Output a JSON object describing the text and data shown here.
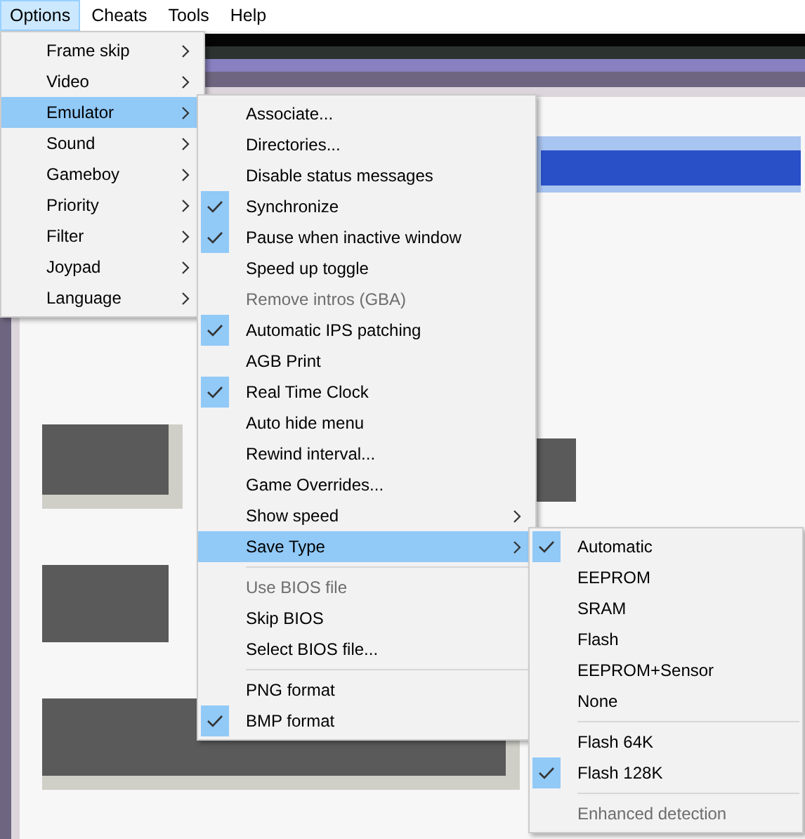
{
  "menu_bar": [
    {
      "label": "Options",
      "selected": true
    },
    {
      "label": "Cheats",
      "selected": false
    },
    {
      "label": "Tools",
      "selected": false
    },
    {
      "label": "Help",
      "selected": false
    }
  ],
  "options_menu": [
    {
      "label": "Frame skip",
      "selected": false,
      "has_submenu": true
    },
    {
      "label": "Video",
      "selected": false,
      "has_submenu": true
    },
    {
      "label": "Emulator",
      "selected": true,
      "has_submenu": true
    },
    {
      "label": "Sound",
      "selected": false,
      "has_submenu": true
    },
    {
      "label": "Gameboy",
      "selected": false,
      "has_submenu": true
    },
    {
      "label": "Priority",
      "selected": false,
      "has_submenu": true
    },
    {
      "label": "Filter",
      "selected": false,
      "has_submenu": true
    },
    {
      "label": "Joypad",
      "selected": false,
      "has_submenu": true
    },
    {
      "label": "Language",
      "selected": false,
      "has_submenu": true
    }
  ],
  "emulator_menu": [
    {
      "kind": "item",
      "label": "Associate...",
      "checked": false,
      "disabled": false,
      "selected": false,
      "has_submenu": false
    },
    {
      "kind": "item",
      "label": "Directories...",
      "checked": false,
      "disabled": false,
      "selected": false,
      "has_submenu": false
    },
    {
      "kind": "item",
      "label": "Disable status messages",
      "checked": false,
      "disabled": false,
      "selected": false,
      "has_submenu": false
    },
    {
      "kind": "item",
      "label": "Synchronize",
      "checked": true,
      "disabled": false,
      "selected": false,
      "has_submenu": false
    },
    {
      "kind": "item",
      "label": "Pause when inactive window",
      "checked": true,
      "disabled": false,
      "selected": false,
      "has_submenu": false
    },
    {
      "kind": "item",
      "label": "Speed up toggle",
      "checked": false,
      "disabled": false,
      "selected": false,
      "has_submenu": false
    },
    {
      "kind": "item",
      "label": "Remove intros (GBA)",
      "checked": false,
      "disabled": true,
      "selected": false,
      "has_submenu": false
    },
    {
      "kind": "item",
      "label": "Automatic IPS patching",
      "checked": true,
      "disabled": false,
      "selected": false,
      "has_submenu": false
    },
    {
      "kind": "item",
      "label": "AGB Print",
      "checked": false,
      "disabled": false,
      "selected": false,
      "has_submenu": false
    },
    {
      "kind": "item",
      "label": "Real Time Clock",
      "checked": true,
      "disabled": false,
      "selected": false,
      "has_submenu": false
    },
    {
      "kind": "item",
      "label": "Auto hide menu",
      "checked": false,
      "disabled": false,
      "selected": false,
      "has_submenu": false
    },
    {
      "kind": "item",
      "label": "Rewind interval...",
      "checked": false,
      "disabled": false,
      "selected": false,
      "has_submenu": false
    },
    {
      "kind": "item",
      "label": "Game Overrides...",
      "checked": false,
      "disabled": false,
      "selected": false,
      "has_submenu": false
    },
    {
      "kind": "item",
      "label": "Show speed",
      "checked": false,
      "disabled": false,
      "selected": false,
      "has_submenu": true
    },
    {
      "kind": "item",
      "label": "Save Type",
      "checked": false,
      "disabled": false,
      "selected": true,
      "has_submenu": true
    },
    {
      "kind": "separator"
    },
    {
      "kind": "item",
      "label": "Use BIOS file",
      "checked": false,
      "disabled": true,
      "selected": false,
      "has_submenu": false
    },
    {
      "kind": "item",
      "label": "Skip BIOS",
      "checked": false,
      "disabled": false,
      "selected": false,
      "has_submenu": false
    },
    {
      "kind": "item",
      "label": "Select BIOS file...",
      "checked": false,
      "disabled": false,
      "selected": false,
      "has_submenu": false
    },
    {
      "kind": "separator"
    },
    {
      "kind": "item",
      "label": "PNG format",
      "checked": false,
      "disabled": false,
      "selected": false,
      "has_submenu": false
    },
    {
      "kind": "item",
      "label": "BMP format",
      "checked": true,
      "disabled": false,
      "selected": false,
      "has_submenu": false
    }
  ],
  "save_type_menu": [
    {
      "kind": "item",
      "label": "Automatic",
      "checked": true,
      "disabled": false,
      "selected": false,
      "has_submenu": false
    },
    {
      "kind": "item",
      "label": "EEPROM",
      "checked": false,
      "disabled": false,
      "selected": false,
      "has_submenu": false
    },
    {
      "kind": "item",
      "label": "SRAM",
      "checked": false,
      "disabled": false,
      "selected": false,
      "has_submenu": false
    },
    {
      "kind": "item",
      "label": "Flash",
      "checked": false,
      "disabled": false,
      "selected": false,
      "has_submenu": false
    },
    {
      "kind": "item",
      "label": "EEPROM+Sensor",
      "checked": false,
      "disabled": false,
      "selected": false,
      "has_submenu": false
    },
    {
      "kind": "item",
      "label": "None",
      "checked": false,
      "disabled": false,
      "selected": false,
      "has_submenu": false
    },
    {
      "kind": "separator"
    },
    {
      "kind": "item",
      "label": "Flash 64K",
      "checked": false,
      "disabled": false,
      "selected": false,
      "has_submenu": false
    },
    {
      "kind": "item",
      "label": "Flash 128K",
      "checked": true,
      "disabled": false,
      "selected": false,
      "has_submenu": false
    },
    {
      "kind": "separator"
    },
    {
      "kind": "item",
      "label": "Enhanced detection",
      "checked": false,
      "disabled": true,
      "selected": false,
      "has_submenu": false
    }
  ]
}
